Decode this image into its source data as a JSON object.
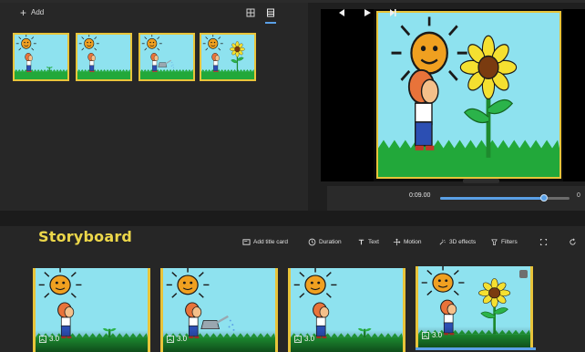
{
  "library": {
    "add_label": "Add",
    "add_icon": "plus-icon",
    "view_icons": [
      "grid-view-icon",
      "list-view-icon"
    ]
  },
  "player": {
    "current_time": "0:09.00",
    "end_time": "0",
    "progress_fraction": 0.8,
    "icons": [
      "rewind-icon",
      "play-icon",
      "step-forward-icon"
    ]
  },
  "storyboard": {
    "title": "Storyboard",
    "toolbar": [
      {
        "label": "Add title card",
        "icon": "title-card-icon"
      },
      {
        "label": "Duration",
        "icon": "clock-icon"
      },
      {
        "label": "Text",
        "icon": "text-icon"
      },
      {
        "label": "Motion",
        "icon": "motion-icon"
      },
      {
        "label": "3D effects",
        "icon": "3d-effects-icon"
      },
      {
        "label": "Filters",
        "icon": "filters-icon"
      }
    ],
    "extra_icons": [
      "resize-icon",
      "rotate-icon"
    ],
    "cards": [
      {
        "duration": "3.0"
      },
      {
        "duration": "3.0"
      },
      {
        "duration": "3.0"
      },
      {
        "duration": "3.0"
      }
    ]
  },
  "colors": {
    "accent": "#5aa0e6",
    "title": "#ecd74a",
    "frame_border": "#e8c43a",
    "sky": "#8ee2ef",
    "grass": "#22a83a",
    "sun": "#f0a020"
  }
}
